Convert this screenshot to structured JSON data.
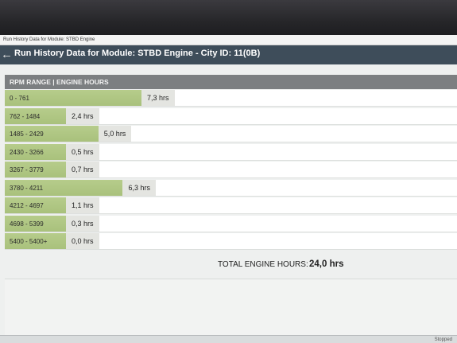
{
  "window": {
    "small_title": "Run History Data for Module: STBD Engine"
  },
  "header": {
    "back_icon": "back-arrow-icon",
    "title": "Run History Data for Module: STBD Engine - City ID: 11(0B)"
  },
  "table": {
    "section_header": "RPM RANGE | ENGINE HOURS",
    "bar_color": "#aec583",
    "rows": [
      {
        "range": "0 - 761",
        "hours": "7,3 hrs",
        "value": 7.3
      },
      {
        "range": "762 - 1484",
        "hours": "2,4 hrs",
        "value": 2.4
      },
      {
        "range": "1485 - 2429",
        "hours": "5,0 hrs",
        "value": 5.0
      },
      {
        "range": "2430 - 3266",
        "hours": "0,5 hrs",
        "value": 0.5
      },
      {
        "range": "3267 - 3779",
        "hours": "0,7 hrs",
        "value": 0.7
      },
      {
        "range": "3780 - 4211",
        "hours": "6,3 hrs",
        "value": 6.3
      },
      {
        "range": "4212 - 4697",
        "hours": "1,1 hrs",
        "value": 1.1
      },
      {
        "range": "4698 - 5399",
        "hours": "0,3 hrs",
        "value": 0.3
      },
      {
        "range": "5400 - 5400+",
        "hours": "0,0 hrs",
        "value": 0.0
      }
    ]
  },
  "total": {
    "label": "TOTAL ENGINE HOURS:",
    "value": "24,0 hrs"
  },
  "taskbar": {
    "right_text": "Stopped"
  }
}
